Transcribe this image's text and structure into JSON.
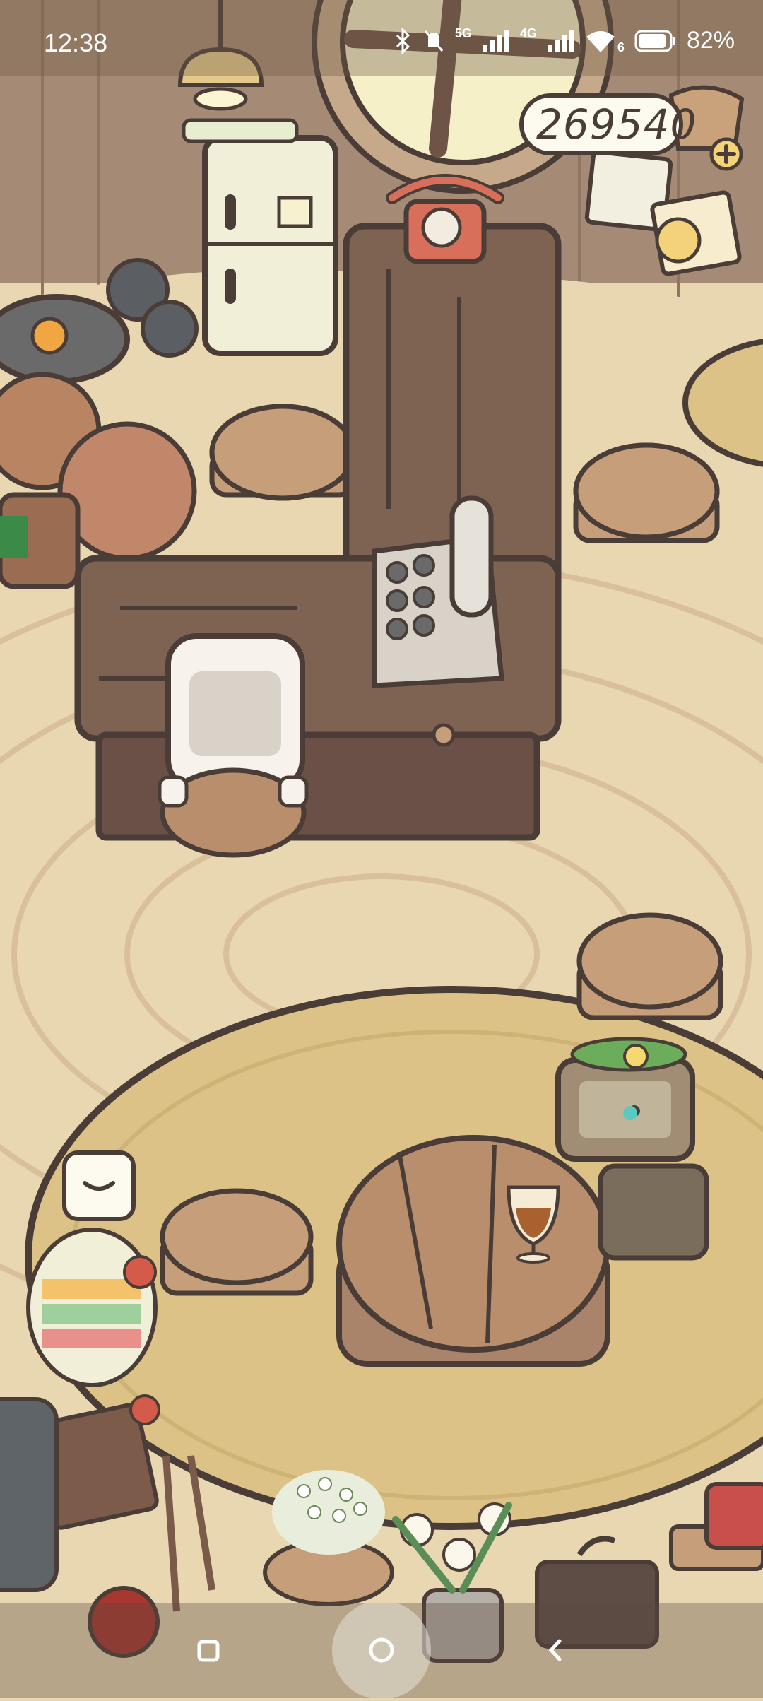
{
  "status_bar": {
    "time": "12:38",
    "network_1": "5G",
    "network_2": "4G",
    "wifi_sub": "6",
    "battery": "82%"
  },
  "hud": {
    "coins": "269540",
    "add_icon": "plus-icon",
    "collapse_icon": "chevron-down-icon"
  },
  "nav": {
    "recents_icon": "square-icon",
    "home_icon": "circle-icon",
    "back_icon": "chevron-left-icon"
  },
  "colors": {
    "floor": "#e9d7b2",
    "outline": "#4a3d38",
    "counter": "#7e6252",
    "rug": "#dcc286"
  }
}
